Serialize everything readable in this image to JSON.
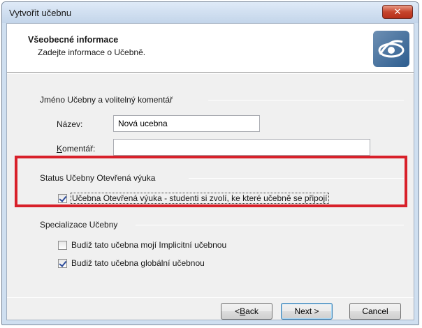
{
  "window": {
    "title": "Vytvořit učebnu",
    "close_glyph": "✕"
  },
  "header": {
    "title": "Všeobecné informace",
    "subtitle": "Zadejte informace o Učebně.",
    "logo_icon": "classroom-eye-logo"
  },
  "name_section": {
    "heading": "Jméno Učebny a volitelný komentář",
    "name_label": "Název:",
    "name_value": "Nová ucebna",
    "comment_label_pre": "K",
    "comment_label_post": "omentář:",
    "comment_value": ""
  },
  "status_section": {
    "heading": "Status Učebny Otevřená výuka",
    "open_class_checkbox": {
      "label": "Učebna Otevřená výuka - studenti si zvolí, ke které učebně se připojí",
      "checked": true
    }
  },
  "specialization_section": {
    "heading": "Specializace Učebny",
    "default_checkbox": {
      "label": "Budiž tato učebna mojí Implicitní učebnou",
      "checked": false
    },
    "global_checkbox": {
      "label": "Budiž tato učebna globální učebnou",
      "checked": true
    }
  },
  "buttons": {
    "back_pre": "< ",
    "back_u": "B",
    "back_post": "ack",
    "next": "Next >",
    "cancel": "Cancel"
  },
  "colors": {
    "highlight_border": "#d8202a",
    "title_bar": "#c3d5ea",
    "close_button": "#c6452d"
  }
}
